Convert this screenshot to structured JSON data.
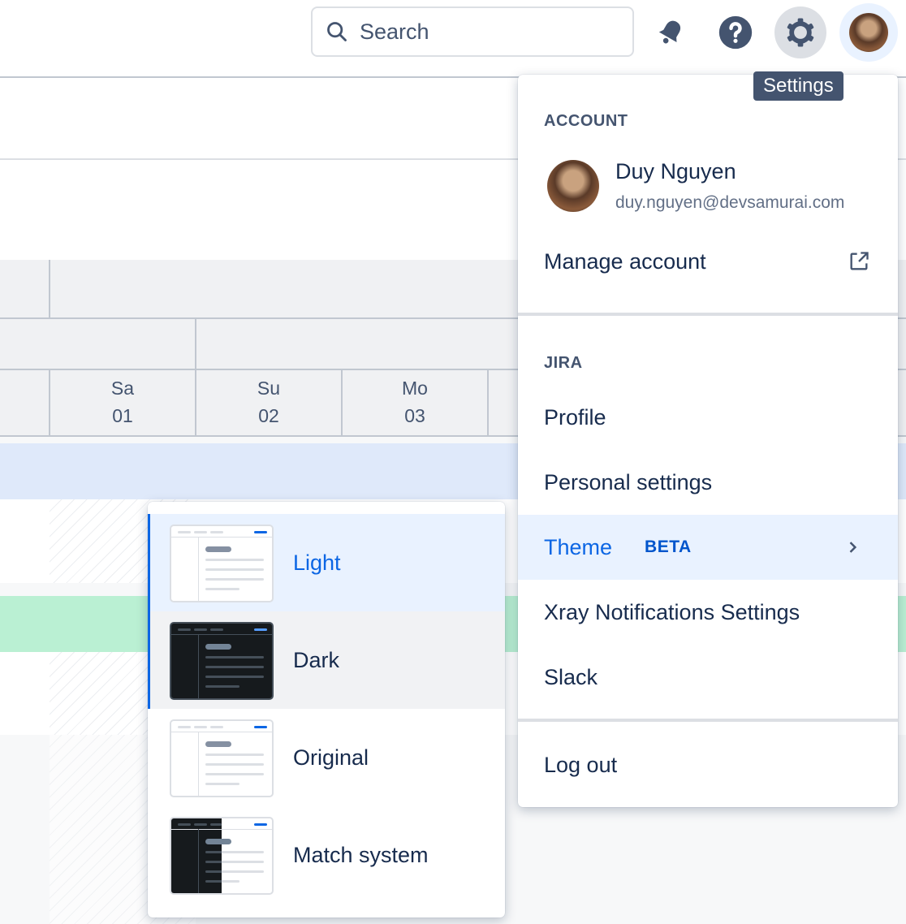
{
  "header": {
    "search_placeholder": "Search",
    "notifications_icon": "bell-icon",
    "help_icon": "question-icon",
    "settings_icon": "gear-icon",
    "settings_tooltip": "Settings"
  },
  "calendar": {
    "days": [
      {
        "weekday": "Sa",
        "date": "01"
      },
      {
        "weekday": "Su",
        "date": "02"
      },
      {
        "weekday": "Mo",
        "date": "03"
      }
    ]
  },
  "profile_menu": {
    "account_heading": "ACCOUNT",
    "user_name": "Duy Nguyen",
    "user_email": "duy.nguyen@devsamurai.com",
    "manage_account": "Manage account",
    "jira_heading": "JIRA",
    "profile": "Profile",
    "personal_settings": "Personal settings",
    "theme": "Theme",
    "theme_badge": "BETA",
    "xray": "Xray Notifications Settings",
    "slack": "Slack",
    "logout": "Log out"
  },
  "theme_menu": {
    "selected": "Light",
    "options": [
      "Light",
      "Dark",
      "Original",
      "Match system"
    ]
  },
  "colors": {
    "accent": "#0c66e4",
    "selected_bg": "#e9f2ff",
    "hover_bg": "#f1f2f4",
    "text": "#172b4d"
  }
}
